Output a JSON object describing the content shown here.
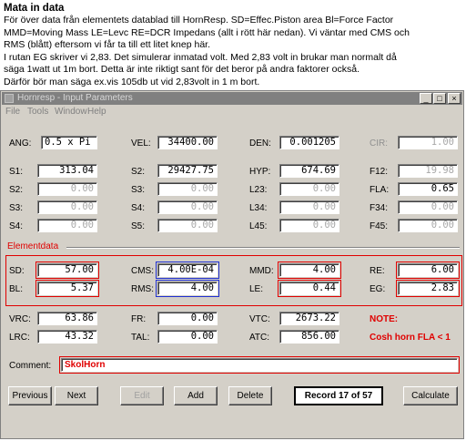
{
  "intro": {
    "heading": "Mata in data",
    "lines": [
      "För över data från elementets datablad till HornResp.   SD=Effec.Piston area   Bl=Force Factor",
      "MMD=Moving Mass  LE=Levc  RE=DCR Impedans (allt i rött här nedan). Vi väntar med CMS och",
      "RMS (blått) eftersom vi får ta till ett litet knep här.",
      "I rutan EG skriver vi 2,83. Det simulerar inmatad volt. Med 2,83 volt in brukar man normalt då",
      "säga 1watt ut 1m bort. Detta är inte riktigt sant för det beror på andra faktorer också.",
      "Därför bör man säga ex.vis 105db ut vid 2,83volt in 1 m bort."
    ]
  },
  "window": {
    "title": "Hornresp - Input Parameters",
    "menu": [
      "File",
      "Tools",
      "Window",
      "Help"
    ]
  },
  "fields": {
    "ang": {
      "label": "ANG:",
      "value": "0.5 x Pi"
    },
    "vel": {
      "label": "VEL:",
      "value": "34400.00"
    },
    "den": {
      "label": "DEN:",
      "value": "0.001205"
    },
    "cir": {
      "label": "CIR:",
      "value": "1.00"
    },
    "s1": {
      "label": "S1:",
      "value": "313.04"
    },
    "s2": {
      "label": "S2:",
      "value": "29427.75"
    },
    "hyp": {
      "label": "HYP:",
      "value": "674.69"
    },
    "f12": {
      "label": "F12:",
      "value": "19.98"
    },
    "s2b": {
      "label": "S2:",
      "value": "0.00"
    },
    "s3": {
      "label": "S3:",
      "value": "0.00"
    },
    "l23": {
      "label": "L23:",
      "value": "0.00"
    },
    "fla": {
      "label": "FLA:",
      "value": "0.65"
    },
    "s3b": {
      "label": "S3:",
      "value": "0.00"
    },
    "s4": {
      "label": "S4:",
      "value": "0.00"
    },
    "l34": {
      "label": "L34:",
      "value": "0.00"
    },
    "f34": {
      "label": "F34:",
      "value": "0.00"
    },
    "s4b": {
      "label": "S4:",
      "value": "0.00"
    },
    "s5": {
      "label": "S5:",
      "value": "0.00"
    },
    "l45": {
      "label": "L45:",
      "value": "0.00"
    },
    "f45": {
      "label": "F45:",
      "value": "0.00"
    },
    "sd": {
      "label": "SD:",
      "value": "57.00"
    },
    "cms": {
      "label": "CMS:",
      "value": "4.00E-04"
    },
    "mmd": {
      "label": "MMD:",
      "value": "4.00"
    },
    "re": {
      "label": "RE:",
      "value": "6.00"
    },
    "bl": {
      "label": "BL:",
      "value": "5.37"
    },
    "rms": {
      "label": "RMS:",
      "value": "4.00"
    },
    "le": {
      "label": "LE:",
      "value": "0.44"
    },
    "eg": {
      "label": "EG:",
      "value": "2.83"
    },
    "vrc": {
      "label": "VRC:",
      "value": "63.86"
    },
    "fr": {
      "label": "FR:",
      "value": "0.00"
    },
    "vtc": {
      "label": "VTC:",
      "value": "2673.22"
    },
    "lrc": {
      "label": "LRC:",
      "value": "43.32"
    },
    "tal": {
      "label": "TAL:",
      "value": "0.00"
    },
    "atc": {
      "label": "ATC:",
      "value": "856.00"
    }
  },
  "element_data_label": "Elementdata",
  "note": {
    "label": "NOTE:",
    "text": "Cosh horn  FLA < 1"
  },
  "comment": {
    "label": "Comment:",
    "value": "SkolHorn"
  },
  "buttons": {
    "previous": "Previous",
    "next": "Next",
    "edit": "Edit",
    "add": "Add",
    "delete": "Delete",
    "record": "Record 17 of 57",
    "calculate": "Calculate"
  },
  "colors": {
    "highlight_red": "#e00000",
    "highlight_blue": "#2030d0",
    "window_bg": "#d4d0c8"
  }
}
